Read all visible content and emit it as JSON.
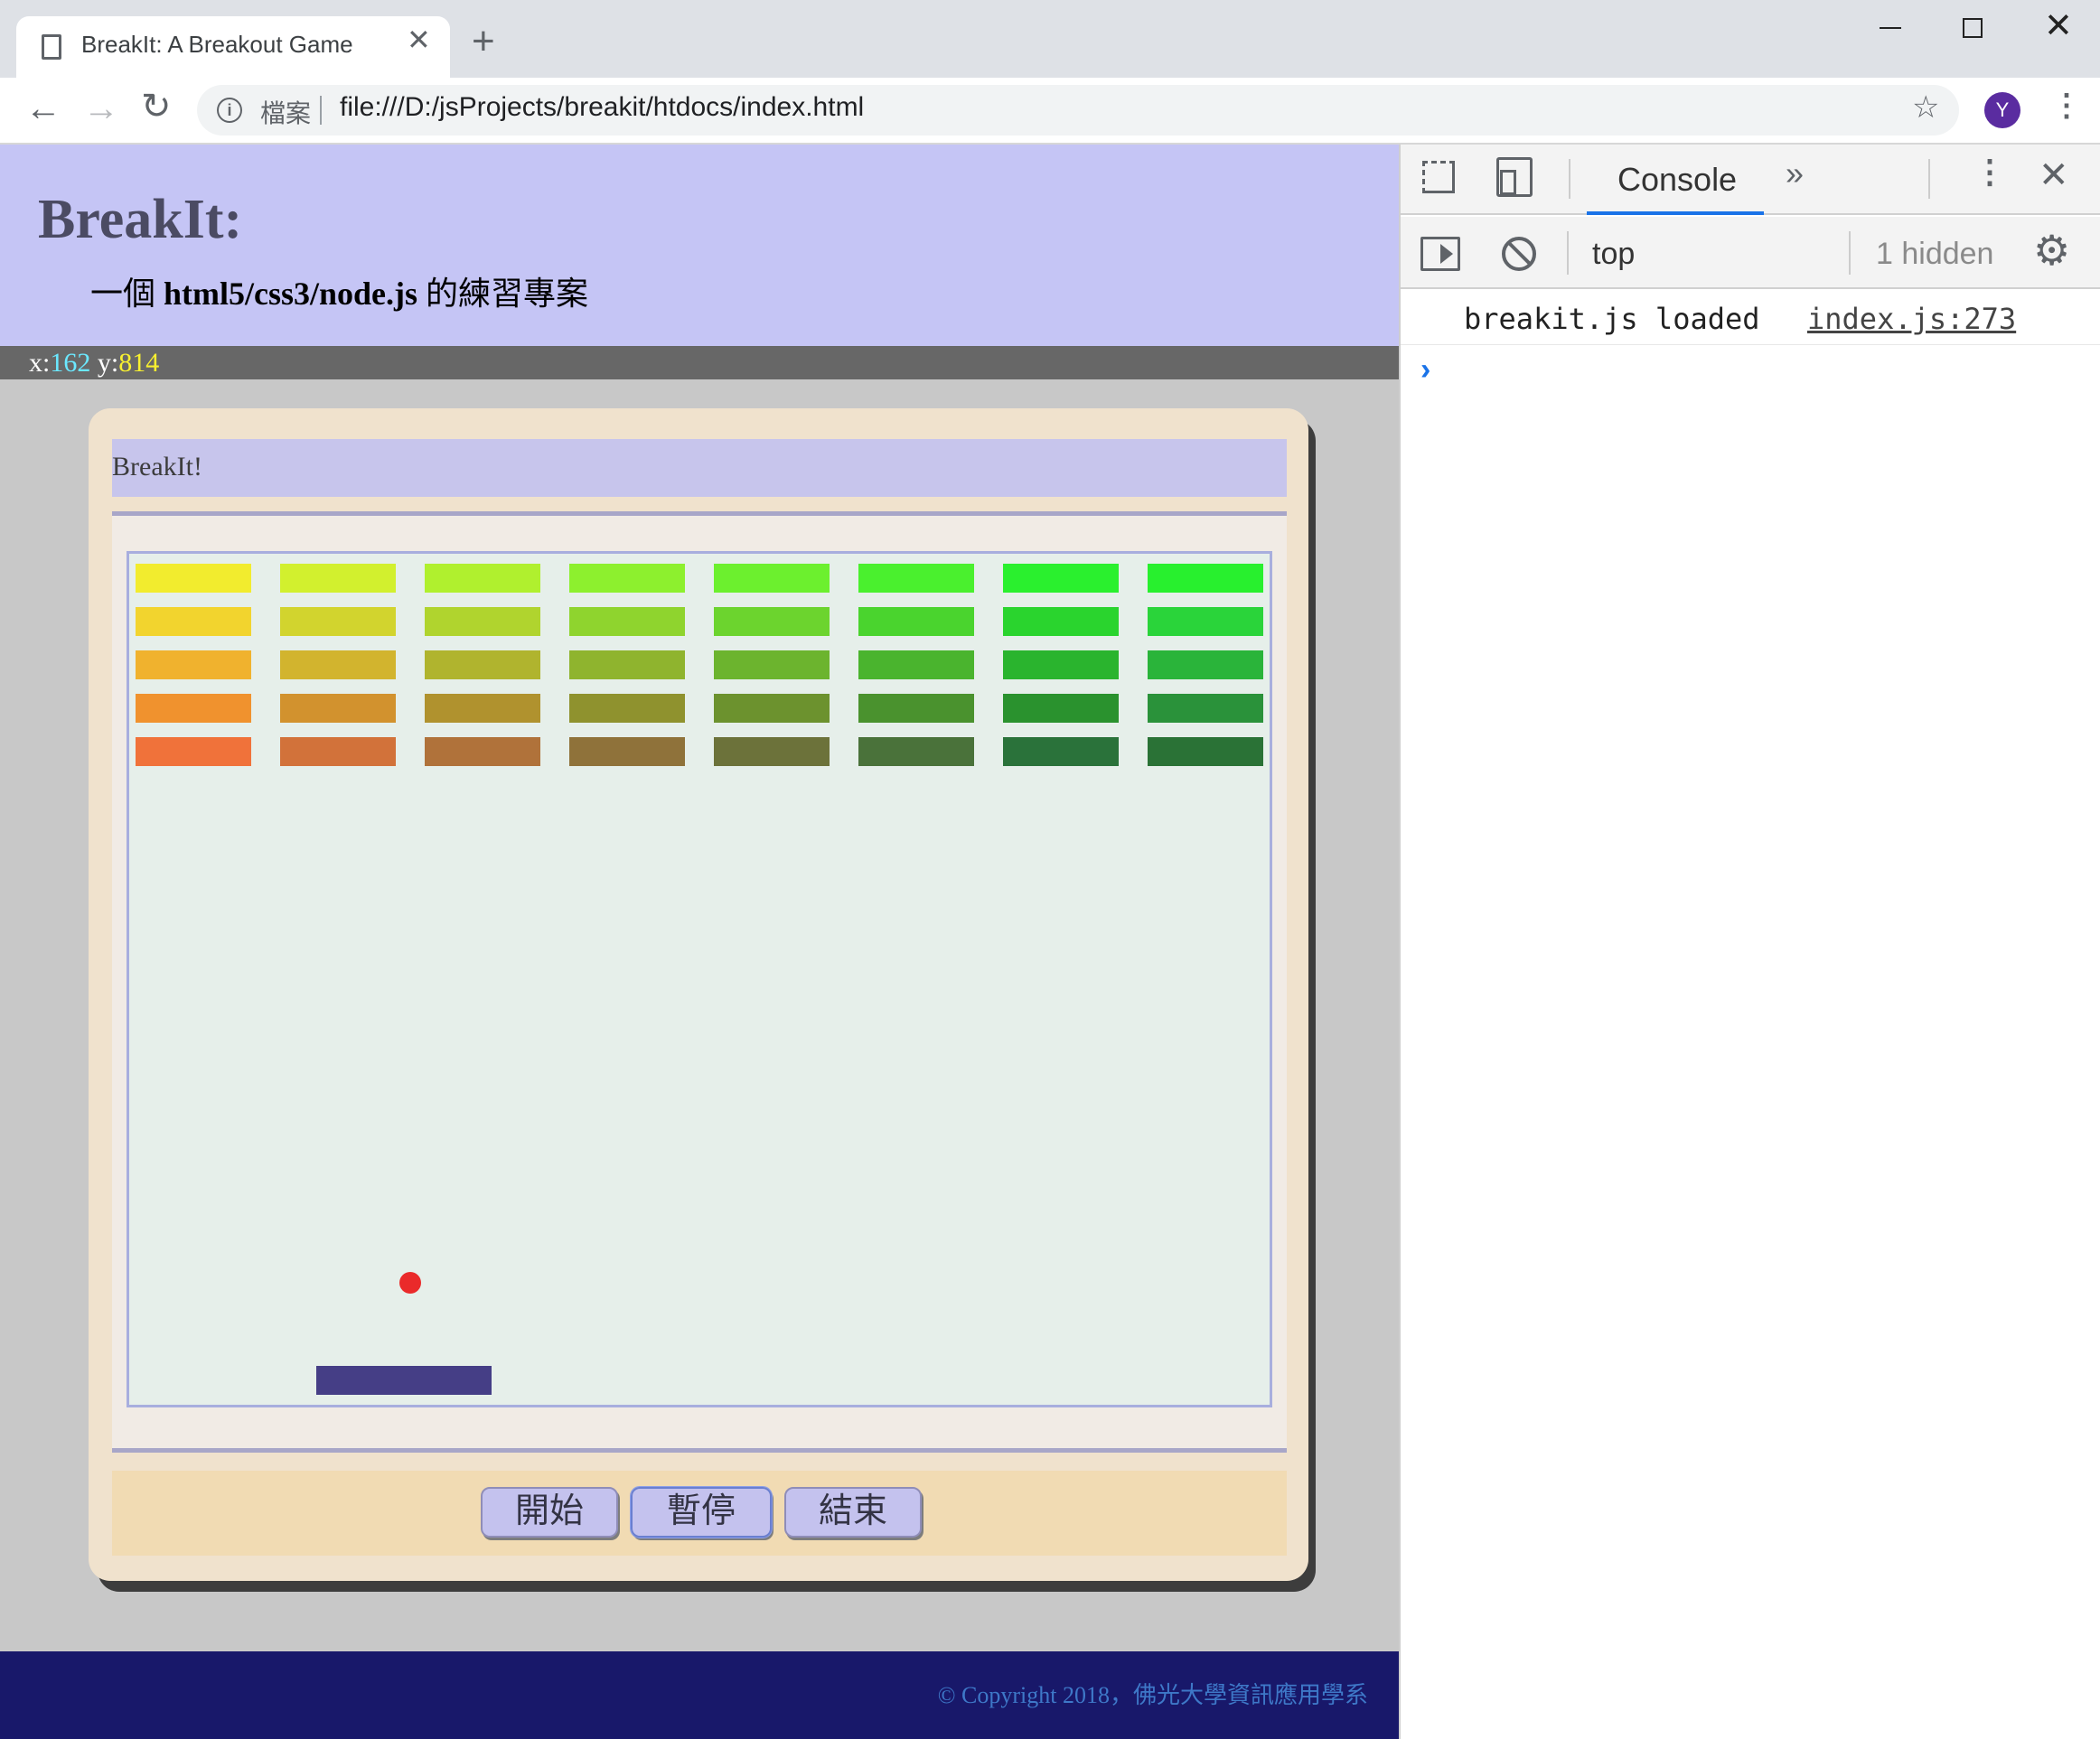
{
  "browser": {
    "tab_title": "BreakIt: A Breakout Game",
    "tab_close_glyph": "✕",
    "new_tab_glyph": "+",
    "url_scheme_label": "檔案",
    "url": "file:///D:/jsProjects/breakit/htdocs/index.html",
    "profile_initial": "Y",
    "window_controls": {
      "close": "✕"
    }
  },
  "page": {
    "title": "BreakIt:",
    "subtitle_prefix": "一個 ",
    "subtitle_bold": "html5/css3/node.js",
    "subtitle_suffix": " 的練習專案",
    "coords": {
      "x_label": "x:",
      "x_value": "162",
      "y_label": " y:",
      "y_value": "814"
    },
    "game": {
      "title": "BreakIt!",
      "buttons": {
        "start": "開始",
        "pause": "暫停",
        "end": "結束"
      },
      "brick_rows": [
        [
          "#f2ec2e",
          "#d2f02e",
          "#b0f02e",
          "#8df02e",
          "#6cf02e",
          "#4af02e",
          "#2af02e",
          "#28f02e"
        ],
        [
          "#f2d42e",
          "#d2d42e",
          "#b0d42e",
          "#8fd42e",
          "#6cd42e",
          "#4ad42e",
          "#2ad42e",
          "#2ad43a"
        ],
        [
          "#f0b22e",
          "#d2b42e",
          "#b0b42e",
          "#8fb42e",
          "#6cb42e",
          "#4ab42e",
          "#2ab42e",
          "#2ab43a"
        ],
        [
          "#f0922e",
          "#d2922e",
          "#b0922e",
          "#8f922e",
          "#6c922e",
          "#4a922e",
          "#2a922e",
          "#2a923a"
        ],
        [
          "#f0723a",
          "#d2723a",
          "#b0723a",
          "#8f723a",
          "#6c723a",
          "#4a723a",
          "#2a723a",
          "#2a7236"
        ]
      ]
    },
    "footer": {
      "copyright": "© Copyright 2018，佛光大學資訊應用學系"
    }
  },
  "devtools": {
    "tab_console": "Console",
    "more_tabs": "»",
    "context": "top",
    "hidden_count": "1 hidden",
    "log_message": "breakit.js loaded",
    "log_source": "index.js:273",
    "prompt": "›"
  },
  "colors": {
    "header_bg": "#c5c5f5",
    "footer_bg": "#18186a",
    "paddle": "#453e86",
    "ball": "#ea2a2a",
    "accent": "#1a73e8"
  }
}
